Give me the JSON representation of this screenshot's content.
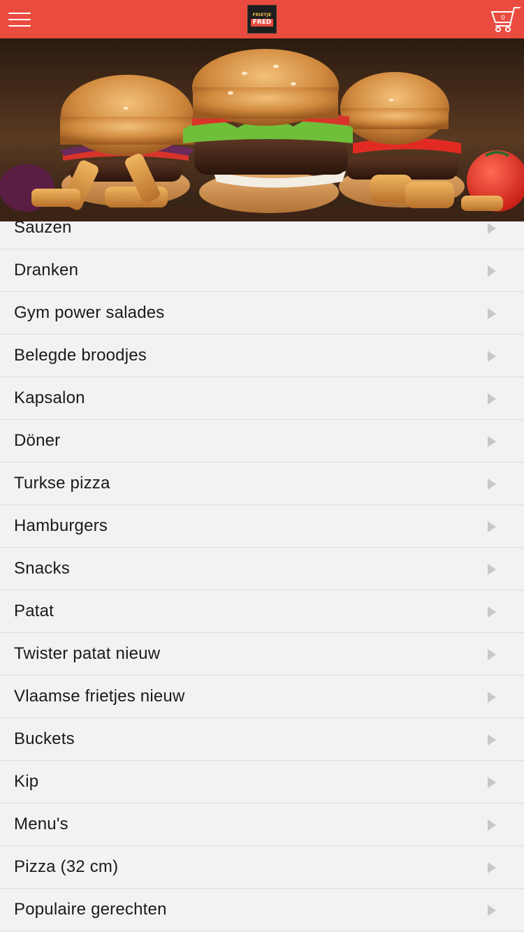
{
  "header": {
    "menu_icon": "hamburger-menu-icon",
    "logo_line1": "FRIETJE",
    "logo_line2": "FRED",
    "cart_icon": "shopping-cart-icon",
    "cart_count": "0"
  },
  "hero": {
    "image": "burgers-and-fries-banner"
  },
  "colors": {
    "header_bg": "#e94c3f",
    "list_bg": "#f2f2f2",
    "divider": "#dcdcdc",
    "arrow": "#c7c7c7"
  },
  "categories": [
    {
      "label": "Sauzen",
      "icon": "chevron-right-icon"
    },
    {
      "label": "Dranken",
      "icon": "chevron-right-icon"
    },
    {
      "label": "Gym power salades",
      "icon": "chevron-right-icon"
    },
    {
      "label": "Belegde broodjes",
      "icon": "chevron-right-icon"
    },
    {
      "label": "Kapsalon",
      "icon": "chevron-right-icon"
    },
    {
      "label": "Döner",
      "icon": "chevron-right-icon"
    },
    {
      "label": "Turkse pizza",
      "icon": "chevron-right-icon"
    },
    {
      "label": "Hamburgers",
      "icon": "chevron-right-icon"
    },
    {
      "label": "Snacks",
      "icon": "chevron-right-icon"
    },
    {
      "label": "Patat",
      "icon": "chevron-right-icon"
    },
    {
      "label": "Twister patat nieuw",
      "icon": "chevron-right-icon"
    },
    {
      "label": "Vlaamse frietjes nieuw",
      "icon": "chevron-right-icon"
    },
    {
      "label": "Buckets",
      "icon": "chevron-right-icon"
    },
    {
      "label": "Kip",
      "icon": "chevron-right-icon"
    },
    {
      "label": "Menu's",
      "icon": "chevron-right-icon"
    },
    {
      "label": "Pizza (32 cm)",
      "icon": "chevron-right-icon"
    },
    {
      "label": "Populaire gerechten",
      "icon": "chevron-right-icon"
    }
  ]
}
